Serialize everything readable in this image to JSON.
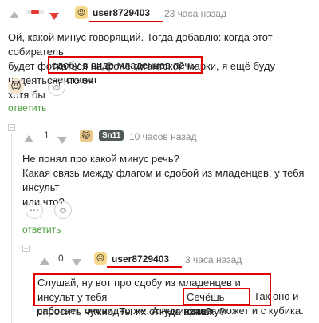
{
  "comments": [
    {
      "username": "user8729403",
      "time": "23 часа назад",
      "text_lines": [
        "Ой, какой минус говорящий. Тогда добавлю: когда этот собиратель",
        "будет фоткаться на фоне гигантской марки, я ещё буду надеяться, что он",
        "хотя бы"
      ],
      "highlight": "сдобу в виде младенцев печь не станет",
      "reaction_emoji": "😈",
      "reply_label": "ответить"
    },
    {
      "score": "1",
      "username": "Sn11",
      "time": "10 часов назад",
      "text_lines": [
        "Не понял про какой минус речь?",
        "Какая связь между флагом и сдобой из младенцев, у тебя инсульт",
        "или что?"
      ],
      "reply_label": "ответить"
    },
    {
      "score": "0",
      "username": "user8729403",
      "time": "3 часа назад",
      "highlight_lines": [
        "Слушай, ну вот про сдобу из младенцев и инсульт у тебя",
        "спросить нужно. Ты их откуда взял?"
      ],
      "highlight2": "Сечёшь фишку?",
      "tail_line1": "Так оно и",
      "tail_line2": "работает, очевидно же. А начинаться может и с кубика."
    }
  ]
}
